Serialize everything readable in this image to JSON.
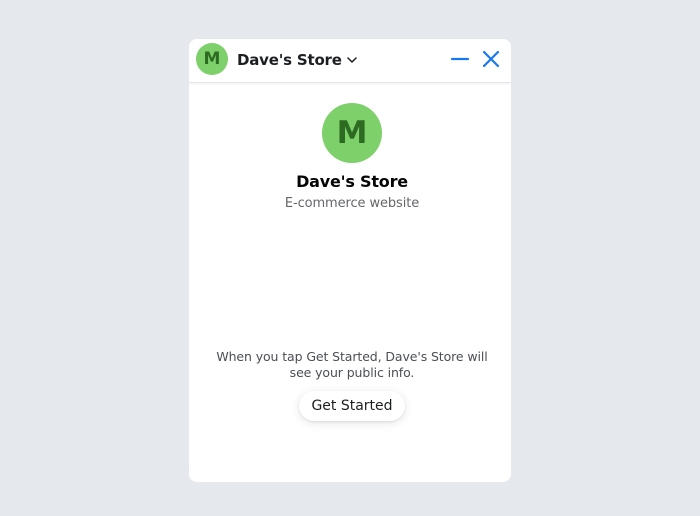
{
  "header": {
    "avatar_letter": "M",
    "title": "Dave's Store",
    "minimize_icon": "minimize-icon",
    "close_icon": "close-icon"
  },
  "profile": {
    "avatar_letter": "M",
    "name": "Dave's Store",
    "subtitle": "E-commerce website"
  },
  "consent": {
    "text": "When you tap Get Started, Dave's Store will see your public info.",
    "button_label": "Get Started"
  },
  "colors": {
    "accent": "#1877f2",
    "avatar_bg": "#7ed06a",
    "avatar_fg": "#2d6b22",
    "page_bg": "#e5e8ec"
  }
}
